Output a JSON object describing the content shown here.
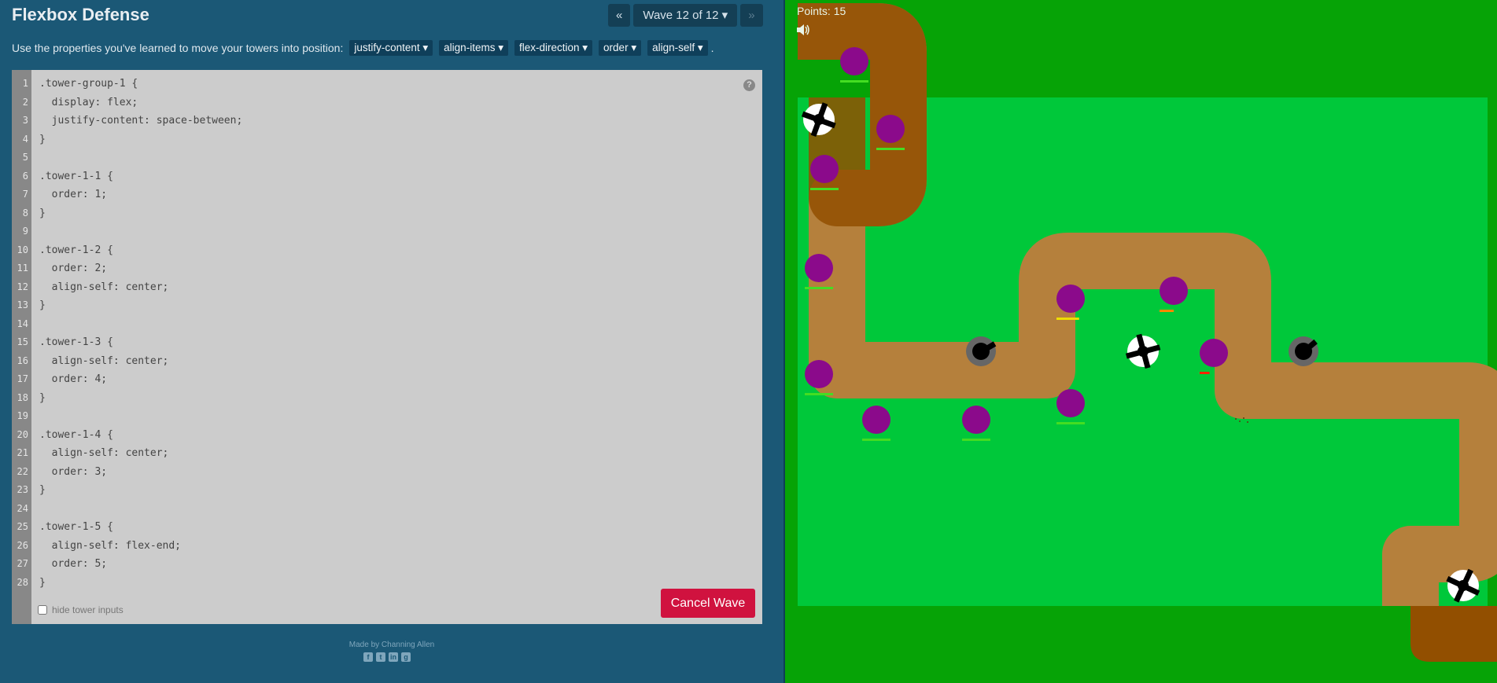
{
  "header": {
    "title": "Flexbox Defense",
    "prev_label": "«",
    "wave_label": "Wave 12 of 12 ▾",
    "next_label": "»"
  },
  "instructions": {
    "text": "Use the properties you've learned to move your towers into position:",
    "properties": [
      "justify-content ▾",
      "align-items ▾",
      "flex-direction ▾",
      "order ▾",
      "align-self ▾"
    ],
    "end": "."
  },
  "editor": {
    "help_label": "?",
    "lines": [
      ".tower-group-1 {",
      "  display: flex;",
      "  justify-content: space-between;",
      "}",
      "",
      ".tower-1-1 {",
      "  order: 1;",
      "}",
      "",
      ".tower-1-2 {",
      "  order: 2;",
      "  align-self: center;",
      "}",
      "",
      ".tower-1-3 {",
      "  align-self: center;",
      "  order: 4;",
      "}",
      "",
      ".tower-1-4 {",
      "  align-self: center;",
      "  order: 3;",
      "}",
      "",
      ".tower-1-5 {",
      "  align-self: flex-end;",
      "  order: 5;",
      "}"
    ],
    "hide_label": "hide tower inputs",
    "cancel_label": "Cancel Wave"
  },
  "footer": {
    "credit": "Made by Channing Allen",
    "social_icons": [
      "facebook-icon",
      "twitter-icon",
      "linkedin-icon",
      "github-icon"
    ],
    "social_glyphs": [
      "f",
      "t",
      "in",
      "g"
    ]
  },
  "game": {
    "points_text": "Points: 15",
    "colors": {
      "grass": "#06a306",
      "zone": "#00c83a",
      "path": "#b5803c",
      "dark_path": "#924f00",
      "enemy": "#8b0a8b"
    },
    "enemies": [
      {
        "health": 1.0,
        "bar": "#44dd22"
      },
      {
        "health": 1.0,
        "bar": "#44dd22"
      },
      {
        "health": 1.0,
        "bar": "#44dd22"
      },
      {
        "health": 1.0,
        "bar": "#44dd22"
      },
      {
        "health": 1.0,
        "bar": "#44dd22"
      },
      {
        "health": 1.0,
        "bar": "#44dd22"
      },
      {
        "health": 1.0,
        "bar": "#44dd22"
      },
      {
        "health": 1.0,
        "bar": "#44dd22"
      },
      {
        "health": 0.8,
        "bar": "#eedd00"
      },
      {
        "health": 0.5,
        "bar": "#ff8800"
      },
      {
        "health": 0.35,
        "bar": "#ff2200"
      }
    ],
    "towers": [
      "gatling",
      "gatling",
      "gatling",
      "cannon",
      "cannon"
    ]
  }
}
